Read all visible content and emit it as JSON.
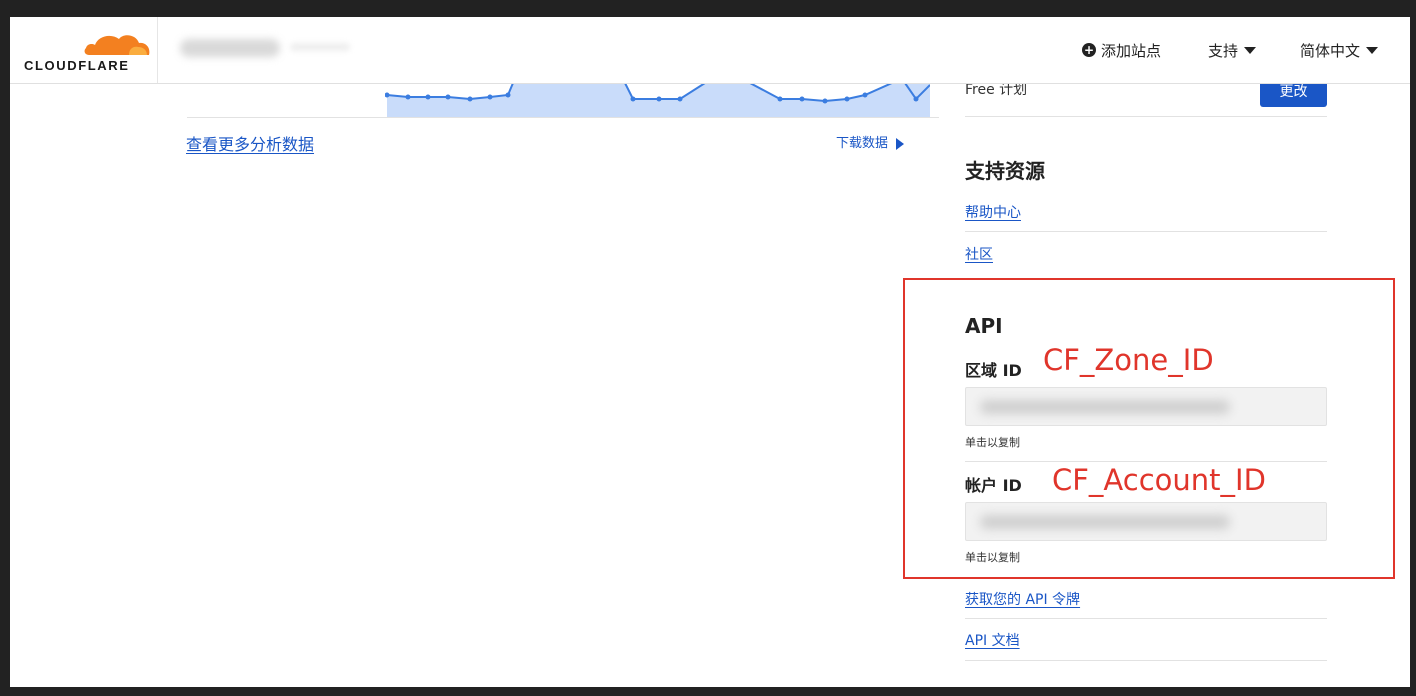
{
  "header": {
    "logo_text": "CLOUDFLARE",
    "nav": {
      "add_site": "添加站点",
      "support": "支持",
      "language": "简体中文"
    }
  },
  "main": {
    "view_more_analytics": "查看更多分析数据",
    "download_data": "下载数据"
  },
  "sidebar": {
    "plan_text": "Free 计划",
    "change_button": "更改",
    "support_resources": {
      "title": "支持资源",
      "links": [
        "帮助中心",
        "社区"
      ]
    },
    "api": {
      "title": "API",
      "zone_id_label": "区域 ID",
      "account_id_label": "帐户 ID",
      "click_to_copy": "单击以复制",
      "get_token_link": "获取您的 API 令牌",
      "docs_link": "API 文档"
    }
  },
  "annotations": {
    "zone_id": "CF_Zone_ID",
    "account_id": "CF_Account_ID",
    "highlight_color": "#e0352b"
  },
  "colors": {
    "brand_orange": "#f38020",
    "link_blue": "#1a56c6",
    "chart_fill": "#c9dcfa",
    "chart_line": "#3b7de0"
  }
}
